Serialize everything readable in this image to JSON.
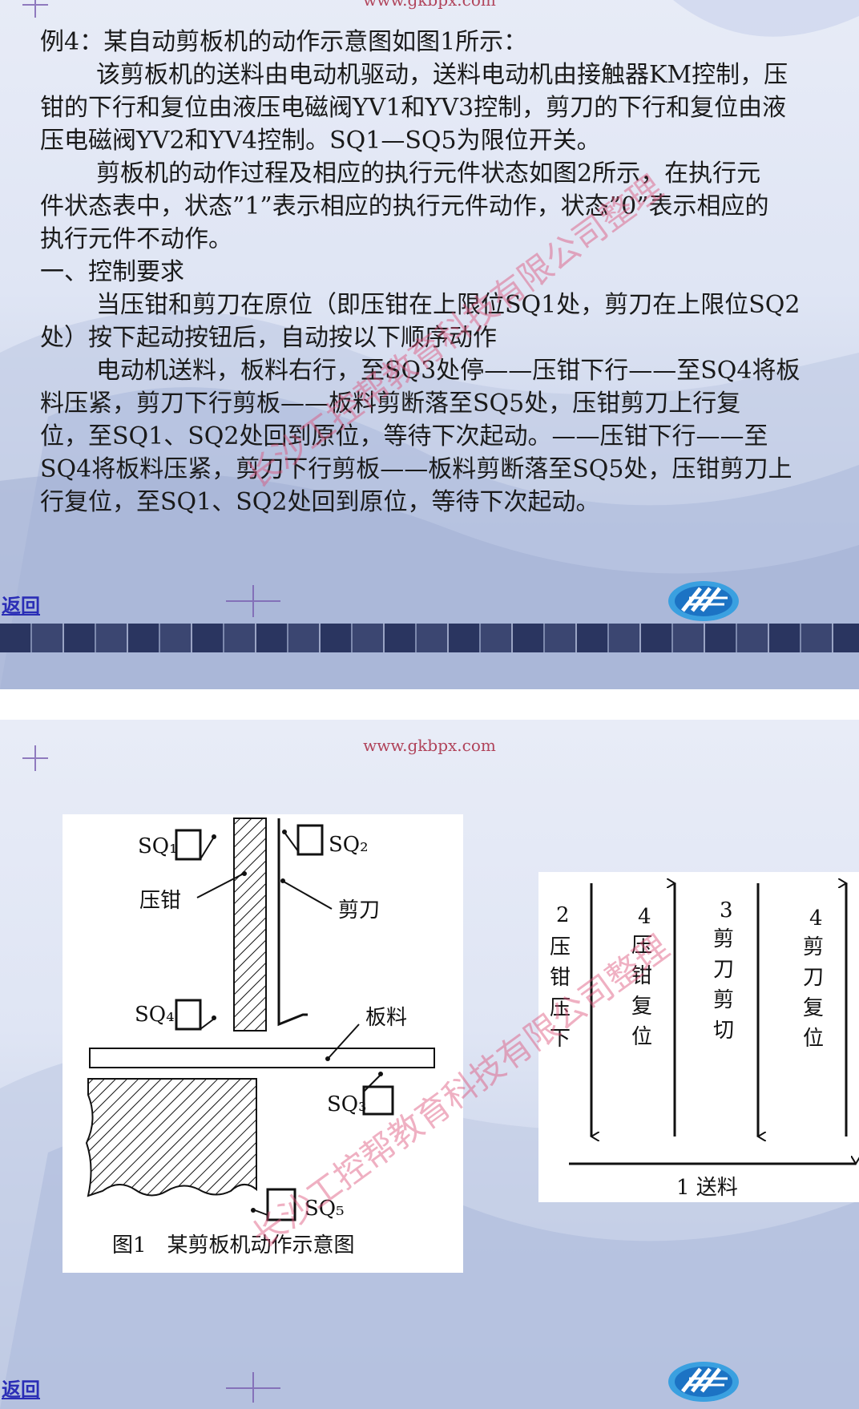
{
  "slide1": {
    "url": "www.gkbpx.com",
    "paragraphs": [
      "例4：某自动剪板机的动作示意图如图1所示：",
      "该剪板机的送料由电动机驱动，送料电动机由接触器KM控制，压",
      "钳的下行和复位由液压电磁阀YV1和YV3控制，剪刀的下行和复位由液",
      "压电磁阀YV2和YV4控制。SQ1—SQ5为限位开关。",
      "剪板机的动作过程及相应的执行元件状态如图2所示，在执行元",
      "件状态表中，状态”1”表示相应的执行元件动作，状态”0”表示相应的",
      "执行元件不动作。",
      "一、控制要求",
      "当压钳和剪刀在原位（即压钳在上限位SQ1处，剪刀在上限位SQ2",
      "处）按下起动按钮后，自动按以下顺序动作",
      "电动机送料，板料右行，至SQ3处停——压钳下行——至SQ4将板",
      "料压紧，剪刀下行剪板——板料剪断落至SQ5处，压钳剪刀上行复",
      "位，至SQ1、SQ2处回到原位，等待下次起动。——压钳下行——至",
      "SQ4将板料压紧，剪刀下行剪板——板料剪断落至SQ5处，压钳剪刀上",
      "行复位，至SQ1、SQ2处回到原位，等待下次起动。"
    ],
    "return_label": "返回",
    "watermark": "长沙工控帮教育科技有限公司整理"
  },
  "slide2": {
    "url": "www.gkbpx.com",
    "figure1": {
      "sq1": "SQ₁",
      "sq2": "SQ₂",
      "sq3": "SQ₃",
      "sq4": "SQ₄",
      "sq5": "SQ₅",
      "clamp": "压钳",
      "blade": "剪刀",
      "sheet": "板料",
      "caption": "图1　某剪板机动作示意图"
    },
    "figure2": {
      "step2_num": "2",
      "step2_label": [
        "压",
        "钳",
        "压",
        "下"
      ],
      "step4a_num": "4",
      "step4a_label": [
        "压",
        "钳",
        "复",
        "位"
      ],
      "step3_num": "3",
      "step3_label": [
        "剪",
        "刀",
        "剪",
        "切"
      ],
      "step4b_num": "4",
      "step4b_label": [
        "剪",
        "刀",
        "复",
        "位"
      ],
      "step1": "1 送料"
    },
    "return_label": "返回",
    "watermark": "长沙工控帮教育科技有限公司整理"
  }
}
